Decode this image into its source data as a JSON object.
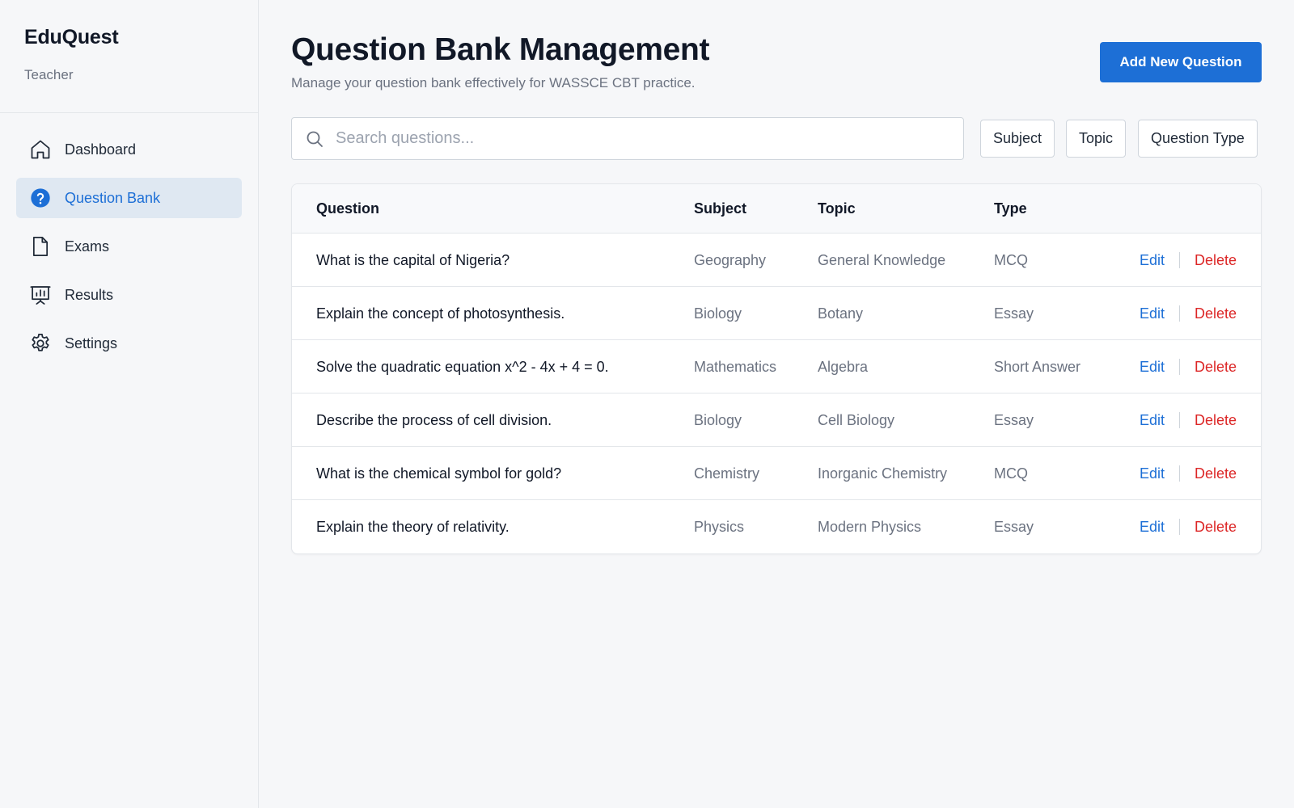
{
  "sidebar": {
    "brand": "EduQuest",
    "role": "Teacher",
    "items": [
      {
        "label": "Dashboard",
        "icon": "home-icon",
        "active": false
      },
      {
        "label": "Question Bank",
        "icon": "question-circle-icon",
        "active": true
      },
      {
        "label": "Exams",
        "icon": "document-icon",
        "active": false
      },
      {
        "label": "Results",
        "icon": "presentation-chart-icon",
        "active": false
      },
      {
        "label": "Settings",
        "icon": "gear-icon",
        "active": false
      }
    ]
  },
  "header": {
    "title": "Question Bank Management",
    "subtitle": "Manage your question bank effectively for WASSCE CBT practice.",
    "add_button": "Add New Question"
  },
  "search": {
    "placeholder": "Search questions...",
    "value": ""
  },
  "filters": {
    "subject": "Subject",
    "topic": "Topic",
    "type": "Question Type"
  },
  "table": {
    "columns": {
      "question": "Question",
      "subject": "Subject",
      "topic": "Topic",
      "type": "Type"
    },
    "rows": [
      {
        "question": "What is the capital of Nigeria?",
        "subject": "Geography",
        "topic": "General Knowledge",
        "type": "MCQ"
      },
      {
        "question": "Explain the concept of photosynthesis.",
        "subject": "Biology",
        "topic": "Botany",
        "type": "Essay"
      },
      {
        "question": "Solve the quadratic equation x^2 - 4x + 4 = 0.",
        "subject": "Mathematics",
        "topic": "Algebra",
        "type": "Short Answer"
      },
      {
        "question": "Describe the process of cell division.",
        "subject": "Biology",
        "topic": "Cell Biology",
        "type": "Essay"
      },
      {
        "question": "What is the chemical symbol for gold?",
        "subject": "Chemistry",
        "topic": "Inorganic Chemistry",
        "type": "MCQ"
      },
      {
        "question": "Explain the theory of relativity.",
        "subject": "Physics",
        "topic": "Modern Physics",
        "type": "Essay"
      }
    ],
    "edit_label": "Edit",
    "delete_label": "Delete"
  },
  "colors": {
    "accent": "#1d6fd6",
    "danger": "#dc2626",
    "active_nav_bg": "#dfe8f2",
    "background": "#f6f7f9"
  }
}
